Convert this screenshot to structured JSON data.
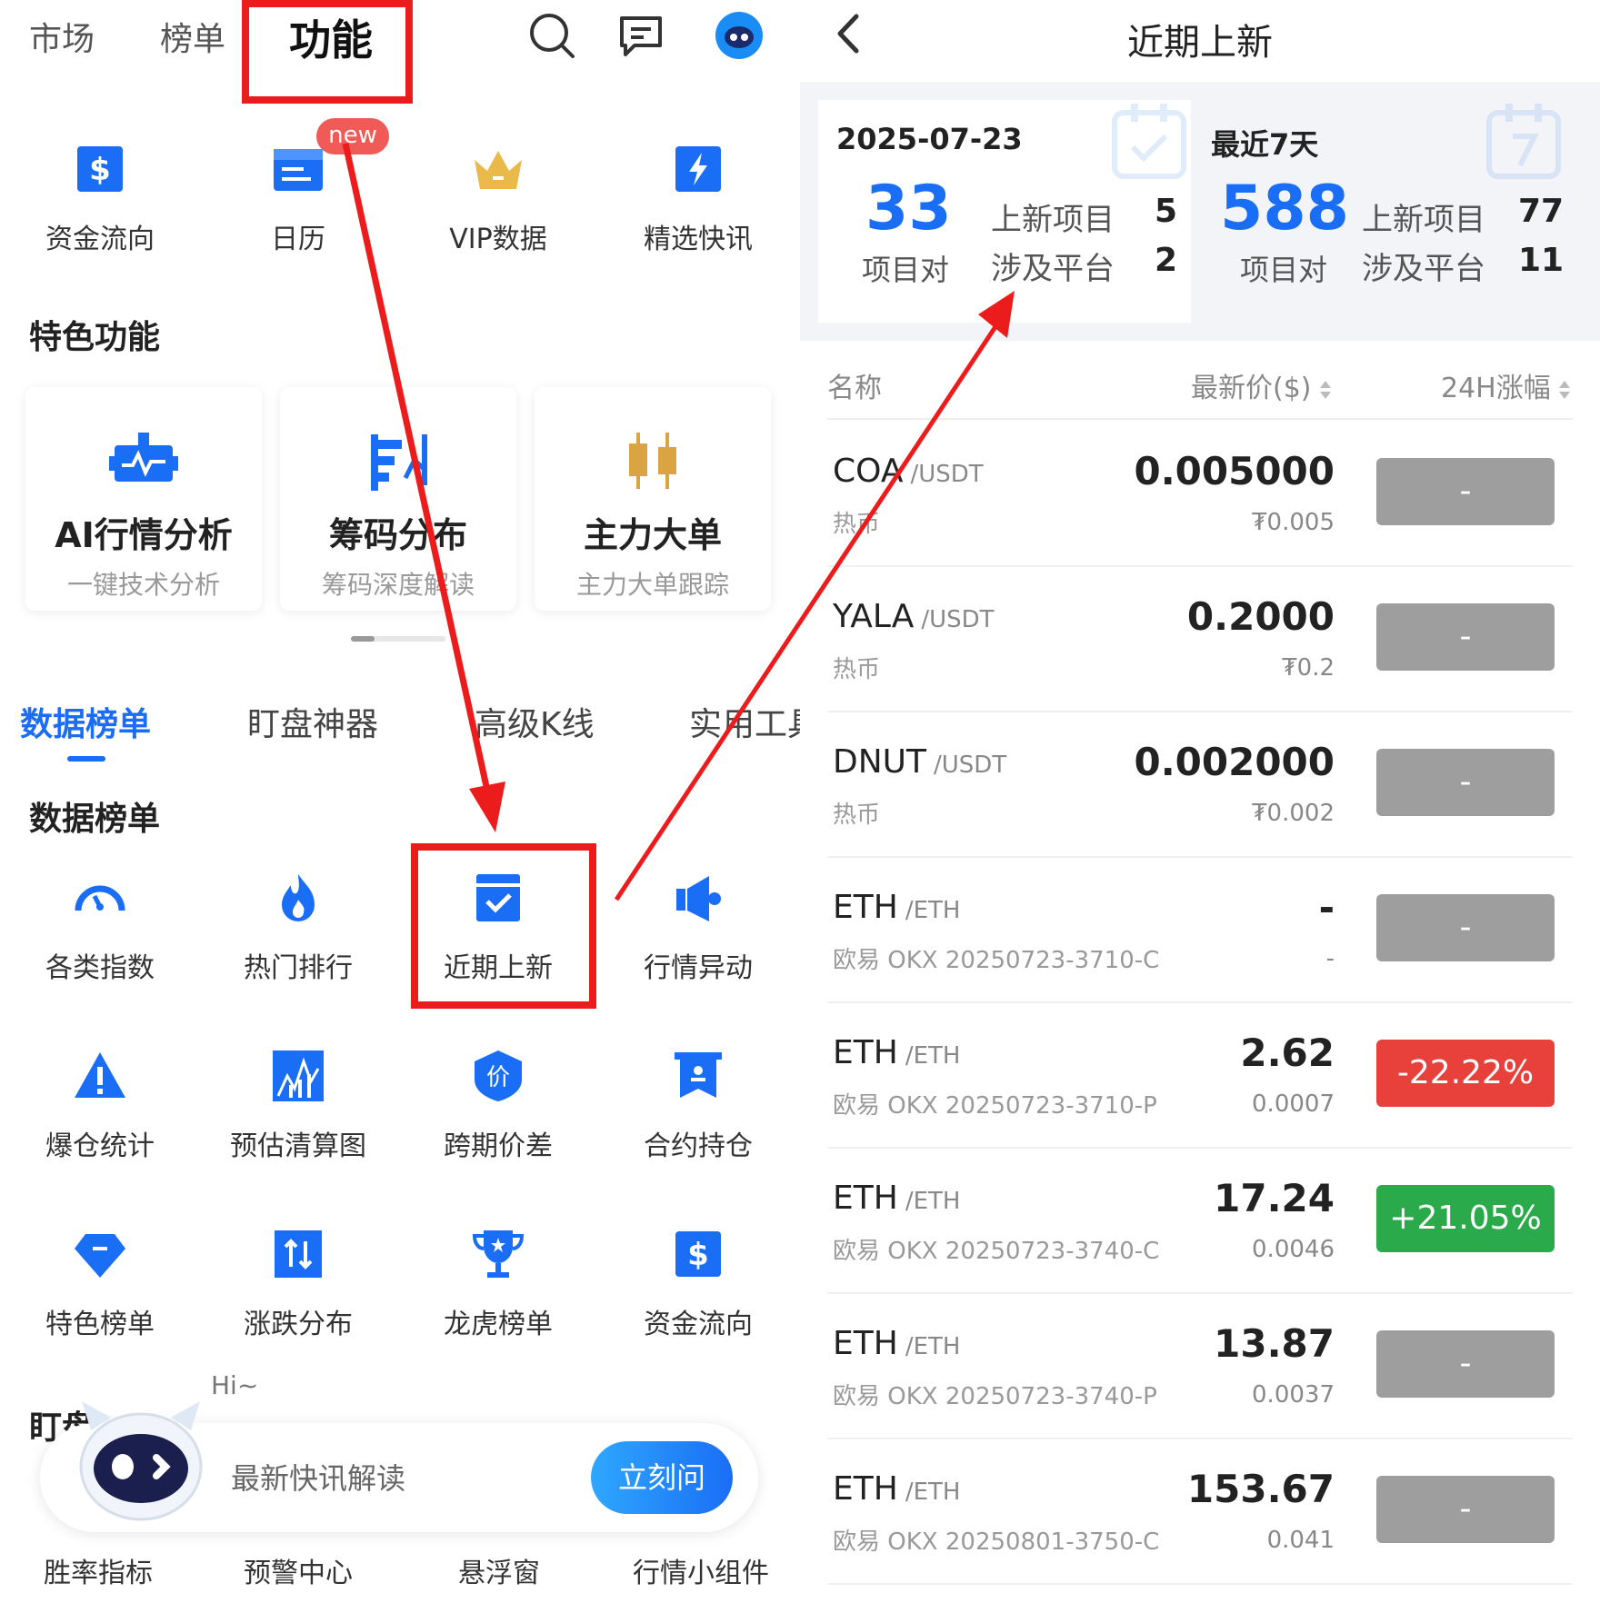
{
  "left": {
    "top_tabs": [
      "市场",
      "榜单",
      "功能"
    ],
    "new_badge": "new",
    "quick_items": [
      {
        "label": "资金流向",
        "icon": "dollar-icon"
      },
      {
        "label": "日历",
        "icon": "calendar-icon"
      },
      {
        "label": "VIP数据",
        "icon": "crown-icon"
      },
      {
        "label": "精选快讯",
        "icon": "lightning-icon"
      }
    ],
    "featured_title": "特色功能",
    "cards": [
      {
        "title": "AI行情分析",
        "subtitle": "一键技术分析",
        "icon": "ai-chart-icon"
      },
      {
        "title": "筹码分布",
        "subtitle": "筹码深度解读",
        "icon": "chip-distribution-icon"
      },
      {
        "title": "主力大单",
        "subtitle": "主力大单跟踪",
        "icon": "candlestick-icon"
      }
    ],
    "sub_tabs": [
      "数据榜单",
      "盯盘神器",
      "高级K线",
      "实用工具"
    ],
    "data_section_title": "数据榜单",
    "data_items": [
      {
        "label": "各类指数",
        "icon": "gauge-icon"
      },
      {
        "label": "热门排行",
        "icon": "flame-icon"
      },
      {
        "label": "近期上新",
        "icon": "calendar-check-icon"
      },
      {
        "label": "行情异动",
        "icon": "megaphone-icon"
      },
      {
        "label": "爆仓统计",
        "icon": "warning-icon"
      },
      {
        "label": "预估清算图",
        "icon": "liquidation-chart-icon"
      },
      {
        "label": "跨期价差",
        "icon": "price-shield-icon"
      },
      {
        "label": "合约持仓",
        "icon": "position-icon"
      },
      {
        "label": "特色榜单",
        "icon": "diamond-icon"
      },
      {
        "label": "涨跌分布",
        "icon": "updown-icon"
      },
      {
        "label": "龙虎榜单",
        "icon": "trophy-icon"
      },
      {
        "label": "资金流向",
        "icon": "dollar-icon"
      }
    ],
    "watch_section_title": "盯盘",
    "assistant": {
      "greeting": "Hi~",
      "hint": "最新快讯解读",
      "button": "立刻问"
    },
    "bottom_items": [
      "胜率指标",
      "预警中心",
      "悬浮窗",
      "行情小组件"
    ]
  },
  "right": {
    "title": "近期上新",
    "today": {
      "date": "2025-07-23",
      "pairs": "33",
      "pairs_label": "项目对",
      "new_label": "上新项目",
      "new_value": "5",
      "platform_label": "涉及平台",
      "platform_value": "2"
    },
    "week": {
      "label": "最近7天",
      "pairs": "588",
      "pairs_label": "项目对",
      "new_label": "上新项目",
      "new_value": "77",
      "platform_label": "涉及平台",
      "platform_value": "11"
    },
    "columns": {
      "name": "名称",
      "price": "最新价($)",
      "change": "24H涨幅"
    },
    "rows": [
      {
        "symbol": "COA",
        "quote": "/USDT",
        "sub": "热币",
        "price": "0.005000",
        "cny": "₮0.005",
        "change": "-",
        "color": "#9e9e9e"
      },
      {
        "symbol": "YALA",
        "quote": "/USDT",
        "sub": "热币",
        "price": "0.2000",
        "cny": "₮0.2",
        "change": "-",
        "color": "#9e9e9e"
      },
      {
        "symbol": "DNUT",
        "quote": "/USDT",
        "sub": "热币",
        "price": "0.002000",
        "cny": "₮0.002",
        "change": "-",
        "color": "#9e9e9e"
      },
      {
        "symbol": "ETH",
        "quote": "/ETH",
        "sub": "欧易 OKX 20250723-3710-C",
        "price": "-",
        "cny": "-",
        "change": "-",
        "color": "#9e9e9e"
      },
      {
        "symbol": "ETH",
        "quote": "/ETH",
        "sub": "欧易 OKX 20250723-3710-P",
        "price": "2.62",
        "cny": "0.0007",
        "change": "-22.22%",
        "color": "#e8413c"
      },
      {
        "symbol": "ETH",
        "quote": "/ETH",
        "sub": "欧易 OKX 20250723-3740-C",
        "price": "17.24",
        "cny": "0.0046",
        "change": "+21.05%",
        "color": "#2aaa4a"
      },
      {
        "symbol": "ETH",
        "quote": "/ETH",
        "sub": "欧易 OKX 20250723-3740-P",
        "price": "13.87",
        "cny": "0.0037",
        "change": "-",
        "color": "#9e9e9e"
      },
      {
        "symbol": "ETH",
        "quote": "/ETH",
        "sub": "欧易 OKX 20250801-3750-C",
        "price": "153.67",
        "cny": "0.041",
        "change": "-",
        "color": "#9e9e9e"
      }
    ]
  },
  "colors": {
    "accent": "#1a6ef5",
    "highlight": "#ec1c1c",
    "up": "#2aaa4a",
    "down": "#e8413c",
    "neutral": "#9e9e9e"
  }
}
